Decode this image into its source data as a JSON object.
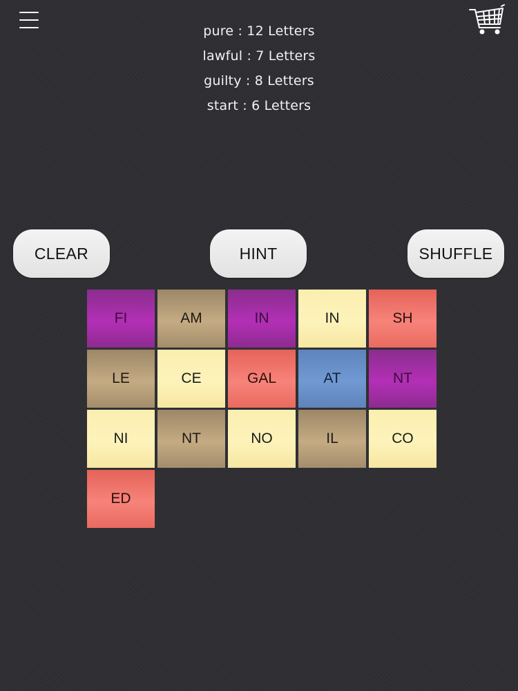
{
  "header": {
    "menu_icon": "menu-icon",
    "cart_icon": "shopping-cart-icon"
  },
  "clues": [
    {
      "text": "pure : 12 Letters"
    },
    {
      "text": "lawful : 7 Letters"
    },
    {
      "text": "guilty : 8 Letters"
    },
    {
      "text": "start : 6 Letters"
    }
  ],
  "buttons": {
    "clear": "CLEAR",
    "hint": "HINT",
    "shuffle": "SHUFFLE"
  },
  "tiles": [
    {
      "label": "FI",
      "color": "purple"
    },
    {
      "label": "AM",
      "color": "tan"
    },
    {
      "label": "IN",
      "color": "purple"
    },
    {
      "label": "IN",
      "color": "yellow"
    },
    {
      "label": "SH",
      "color": "red"
    },
    {
      "label": "LE",
      "color": "tan"
    },
    {
      "label": "CE",
      "color": "yellow"
    },
    {
      "label": "GAL",
      "color": "red"
    },
    {
      "label": "AT",
      "color": "blue"
    },
    {
      "label": "NT",
      "color": "purple"
    },
    {
      "label": "NI",
      "color": "yellow"
    },
    {
      "label": "NT",
      "color": "tan"
    },
    {
      "label": "NO",
      "color": "yellow"
    },
    {
      "label": "IL",
      "color": "tan"
    },
    {
      "label": "CO",
      "color": "yellow"
    },
    {
      "label": "ED",
      "color": "red"
    }
  ],
  "colors": {
    "background": "#2f2f33",
    "purple": "#b32fb6",
    "tan": "#c4ab84",
    "yellow": "#fdf3ba",
    "red": "#f7837a",
    "blue": "#7199d2",
    "button": "#eeeeee"
  }
}
